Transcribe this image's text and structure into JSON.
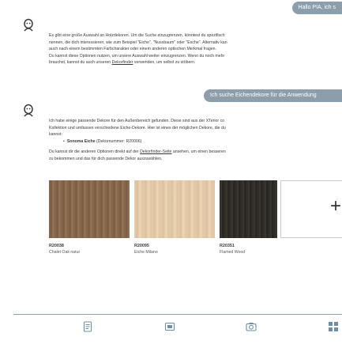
{
  "chat": {
    "user_message_1": "Hallo PIA, ich s",
    "assistant_message_1": [
      "Es gibt eine große Auswahl an Holzdekoren. Um die Suche einzugrenzen, könntest du spezifisch",
      "nennen, die dich interessieren, wie zum Beispiel \"Eiche\", \"Nussbaum\" oder \"Esche\". Alternativ kan",
      "auch nach einem bestimmten Farbcharakter oder einem anderen optischen Merkmal fragen."
    ],
    "assistant_message_1_link_line": {
      "before": "Du kannst diese Optionen nutzen, um unsere Auswahl weiter einzugrenzen. Wenn du noch mehr",
      "before_2": "brauchst, kannst du auch unseren ",
      "link": "Dekorfinder",
      "after": " verwenden, um selbst zu stöbern."
    },
    "user_message_2": "Ich suche Eichendekore für die Anwendung",
    "assistant_message_2": [
      "Ich habe einige passende Dekore für den Außenbereich gefunden. Diese sind aus der XTerior co",
      "Kollektion und umfassen verschiedene Eiche-Dekore. Hier ist eines der möglichen Dekore, die du",
      "kannst:"
    ],
    "bullet": {
      "name": "Sonoma Eiche",
      "detail": " (Dekornummer: R20006)"
    },
    "assistant_message_2_link_line": {
      "before": "Du kannst dir die anderen Optionen direkt auf der ",
      "link": "Dekorfinder-Seite",
      "after": " ansehen, um einen besseren",
      "line_2": "zu bekommen und das für dich passende Dekor auszuwählen."
    }
  },
  "swatches": [
    {
      "code": "R20038",
      "name": "Chalet Oak natur"
    },
    {
      "code": "R20095",
      "name": "Eiche Milano"
    },
    {
      "code": "R20351",
      "name": "Flamed Wood"
    }
  ],
  "add_tile_symbol": "+",
  "colors": {
    "user_bubble": "#8c9eac",
    "divider": "#8ca0b0",
    "nav_icon": "#6e8fa6"
  },
  "nav": [
    "doc-icon",
    "tile-icon",
    "camera-icon",
    "grid-icon"
  ]
}
